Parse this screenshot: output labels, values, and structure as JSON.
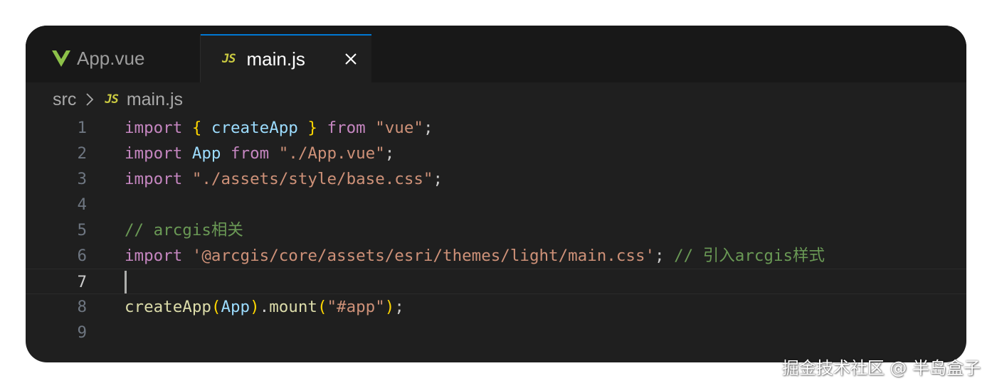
{
  "tabs": [
    {
      "label": "App.vue",
      "icon": "vue-icon",
      "active": false
    },
    {
      "label": "main.js",
      "icon": "js-icon",
      "active": true
    }
  ],
  "js_icon_text": "JS",
  "breadcrumb": {
    "folder": "src",
    "file": "main.js"
  },
  "editor": {
    "current_line": 7,
    "lines": [
      {
        "n": "1",
        "tokens": [
          [
            "kw",
            "import"
          ],
          [
            "pl",
            " "
          ],
          [
            "br",
            "{"
          ],
          [
            "pl",
            " "
          ],
          [
            "id",
            "createApp"
          ],
          [
            "pl",
            " "
          ],
          [
            "br",
            "}"
          ],
          [
            "pl",
            " "
          ],
          [
            "kw",
            "from"
          ],
          [
            "pl",
            " "
          ],
          [
            "str",
            "\"vue\""
          ],
          [
            "pl",
            ";"
          ]
        ]
      },
      {
        "n": "2",
        "tokens": [
          [
            "kw",
            "import"
          ],
          [
            "pl",
            " "
          ],
          [
            "id",
            "App"
          ],
          [
            "pl",
            " "
          ],
          [
            "kw",
            "from"
          ],
          [
            "pl",
            " "
          ],
          [
            "str",
            "\"./App.vue\""
          ],
          [
            "pl",
            ";"
          ]
        ]
      },
      {
        "n": "3",
        "tokens": [
          [
            "kw",
            "import"
          ],
          [
            "pl",
            " "
          ],
          [
            "str",
            "\"./assets/style/base.css\""
          ],
          [
            "pl",
            ";"
          ]
        ]
      },
      {
        "n": "4",
        "tokens": []
      },
      {
        "n": "5",
        "tokens": [
          [
            "cm",
            "// arcgis相关"
          ]
        ]
      },
      {
        "n": "6",
        "tokens": [
          [
            "kw",
            "import"
          ],
          [
            "pl",
            " "
          ],
          [
            "str",
            "'@arcgis/core/assets/esri/themes/light/main.css'"
          ],
          [
            "pl",
            "; "
          ],
          [
            "cm",
            "// 引入arcgis样式"
          ]
        ]
      },
      {
        "n": "7",
        "tokens": []
      },
      {
        "n": "8",
        "tokens": [
          [
            "fn",
            "createApp"
          ],
          [
            "br",
            "("
          ],
          [
            "id",
            "App"
          ],
          [
            "br",
            ")"
          ],
          [
            "pl",
            "."
          ],
          [
            "fn",
            "mount"
          ],
          [
            "br",
            "("
          ],
          [
            "str",
            "\"#app\""
          ],
          [
            "br",
            ")"
          ],
          [
            "pl",
            ";"
          ]
        ]
      },
      {
        "n": "9",
        "tokens": []
      }
    ]
  },
  "colors": {
    "keyword": "#c586c0",
    "string": "#ce9178",
    "comment": "#6a9955",
    "identifier": "#9cdcfe",
    "function": "#dcdcaa",
    "bracket": "#ffd700",
    "active_tab_border": "#0078d4",
    "vue_green": "#41b883"
  },
  "watermark": "掘金技术社区 @ 半岛盒子"
}
